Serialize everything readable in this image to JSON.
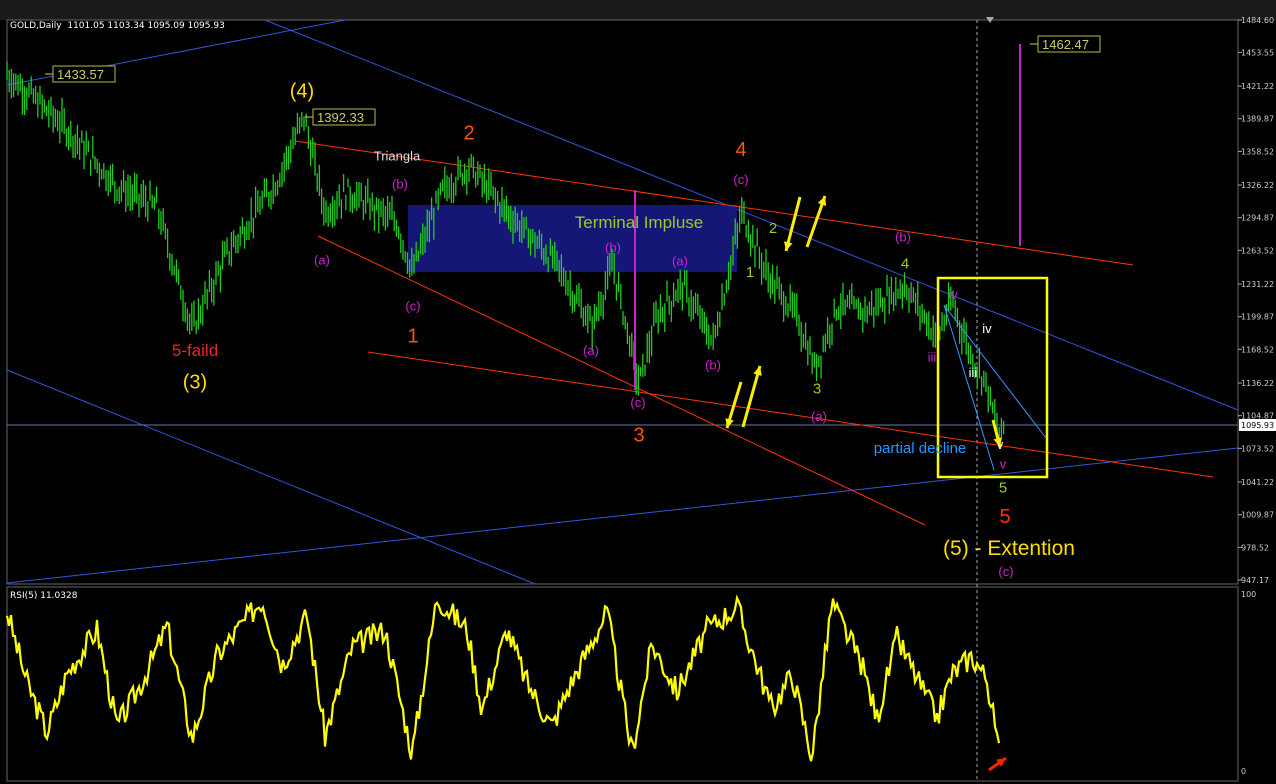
{
  "header": {
    "symbol_line": "GOLD,Daily  1101.05 1103.34 1095.09 1095.93",
    "rsi_line": "RSI(5) 11.0328"
  },
  "colors": {
    "candle": "#22cc22",
    "rsi": "#ffff00",
    "trend_red": "#ff3300",
    "trend_blue": "#3355dd",
    "magenta": "#cc22cc",
    "yellow_box": "#ffff00",
    "terminal_box": "#1a1a8c"
  },
  "chart_data": {
    "type": "candlestick",
    "symbol": "GOLD",
    "timeframe": "Daily",
    "ohlc_last": {
      "open": 1101.05,
      "high": 1103.34,
      "low": 1095.09,
      "close": 1095.93
    },
    "price_axis_ticks": [
      "1484.60",
      "1453.55",
      "1421.22",
      "1389.87",
      "1358.52",
      "1326.22",
      "1294.87",
      "1263.52",
      "1231.22",
      "1199.87",
      "1168.52",
      "1136.22",
      "1104.87",
      "1073.52",
      "1041.22",
      "1009.87",
      "978.52",
      "947.17"
    ],
    "current_price_tag": "1095.93",
    "ylim": [
      947.17,
      1484.6
    ],
    "price_labels": [
      {
        "text": "1433.57",
        "price": 1433.57
      },
      {
        "text": "1392.33",
        "price": 1392.33
      },
      {
        "text": "1462.47",
        "price": 1462.47
      }
    ],
    "path_anchors": [
      {
        "t": 0,
        "p": 1433
      },
      {
        "t": 60,
        "p": 1380
      },
      {
        "t": 110,
        "p": 1325
      },
      {
        "t": 150,
        "p": 1305
      },
      {
        "t": 185,
        "p": 1188
      },
      {
        "t": 220,
        "p": 1260
      },
      {
        "t": 270,
        "p": 1330
      },
      {
        "t": 297,
        "p": 1392
      },
      {
        "t": 318,
        "p": 1300
      },
      {
        "t": 340,
        "p": 1320
      },
      {
        "t": 390,
        "p": 1290
      },
      {
        "t": 405,
        "p": 1242
      },
      {
        "t": 435,
        "p": 1320
      },
      {
        "t": 462,
        "p": 1345
      },
      {
        "t": 500,
        "p": 1300
      },
      {
        "t": 550,
        "p": 1250
      },
      {
        "t": 585,
        "p": 1190
      },
      {
        "t": 606,
        "p": 1250
      },
      {
        "t": 632,
        "p": 1135
      },
      {
        "t": 650,
        "p": 1200
      },
      {
        "t": 675,
        "p": 1230
      },
      {
        "t": 706,
        "p": 1175
      },
      {
        "t": 735,
        "p": 1300
      },
      {
        "t": 760,
        "p": 1240
      },
      {
        "t": 790,
        "p": 1200
      },
      {
        "t": 808,
        "p": 1150
      },
      {
        "t": 830,
        "p": 1210
      },
      {
        "t": 860,
        "p": 1205
      },
      {
        "t": 898,
        "p": 1230
      },
      {
        "t": 930,
        "p": 1180
      },
      {
        "t": 945,
        "p": 1215
      },
      {
        "t": 965,
        "p": 1160
      },
      {
        "t": 978,
        "p": 1140
      },
      {
        "t": 992,
        "p": 1085
      },
      {
        "t": 998,
        "p": 1096
      }
    ],
    "rsi": {
      "name": "RSI(5)",
      "last_value": 11.0328,
      "ticks": [
        "100",
        "0"
      ],
      "ylim": [
        0,
        100
      ],
      "path_anchors": [
        {
          "t": 0,
          "v": 90
        },
        {
          "t": 20,
          "v": 50
        },
        {
          "t": 40,
          "v": 22
        },
        {
          "t": 60,
          "v": 55
        },
        {
          "t": 90,
          "v": 80
        },
        {
          "t": 110,
          "v": 25
        },
        {
          "t": 135,
          "v": 50
        },
        {
          "t": 160,
          "v": 82
        },
        {
          "t": 185,
          "v": 18
        },
        {
          "t": 210,
          "v": 65
        },
        {
          "t": 255,
          "v": 97
        },
        {
          "t": 275,
          "v": 60
        },
        {
          "t": 300,
          "v": 88
        },
        {
          "t": 318,
          "v": 20
        },
        {
          "t": 345,
          "v": 70
        },
        {
          "t": 378,
          "v": 80
        },
        {
          "t": 405,
          "v": 10
        },
        {
          "t": 430,
          "v": 98
        },
        {
          "t": 460,
          "v": 80
        },
        {
          "t": 475,
          "v": 35
        },
        {
          "t": 500,
          "v": 80
        },
        {
          "t": 520,
          "v": 50
        },
        {
          "t": 545,
          "v": 25
        },
        {
          "t": 560,
          "v": 45
        },
        {
          "t": 600,
          "v": 90
        },
        {
          "t": 625,
          "v": 10
        },
        {
          "t": 645,
          "v": 72
        },
        {
          "t": 670,
          "v": 45
        },
        {
          "t": 700,
          "v": 80
        },
        {
          "t": 730,
          "v": 93
        },
        {
          "t": 765,
          "v": 35
        },
        {
          "t": 785,
          "v": 55
        },
        {
          "t": 805,
          "v": 8
        },
        {
          "t": 825,
          "v": 95
        },
        {
          "t": 855,
          "v": 60
        },
        {
          "t": 870,
          "v": 30
        },
        {
          "t": 890,
          "v": 75
        },
        {
          "t": 930,
          "v": 30
        },
        {
          "t": 945,
          "v": 55
        },
        {
          "t": 965,
          "v": 65
        },
        {
          "t": 980,
          "v": 52
        },
        {
          "t": 992,
          "v": 11
        }
      ]
    },
    "annotations": [
      {
        "text": "(4)",
        "color": "#ffdd00",
        "t": 295,
        "p": 1410
      },
      {
        "text": "5-faild",
        "color": "#ee2222",
        "t": 188,
        "p": 1162
      },
      {
        "text": "(3)",
        "color": "#ffdd00",
        "t": 188,
        "p": 1131
      },
      {
        "text": "Triangla",
        "color": "#dddddd",
        "t": 390,
        "p": 1350
      },
      {
        "text": "(b)",
        "color": "#cc22cc",
        "t": 393,
        "p": 1323
      },
      {
        "text": "(a)",
        "color": "#cc22cc",
        "t": 315,
        "p": 1250
      },
      {
        "text": "(c)",
        "color": "#cc22cc",
        "t": 406,
        "p": 1206
      },
      {
        "text": "1",
        "color": "#ff5500",
        "t": 406,
        "p": 1175
      },
      {
        "text": "2",
        "color": "#ff5500",
        "t": 462,
        "p": 1370
      },
      {
        "text": "Terminal Impluse",
        "color": "#99cc22",
        "t": 632,
        "p": 1285
      },
      {
        "text": "(b)",
        "color": "#cc22cc",
        "t": 606,
        "p": 1262
      },
      {
        "text": "(a)",
        "color": "#cc22cc",
        "t": 673,
        "p": 1249
      },
      {
        "text": "(a)",
        "color": "#cc22cc",
        "t": 584,
        "p": 1163
      },
      {
        "text": "(b)",
        "color": "#cc22cc",
        "t": 706,
        "p": 1149
      },
      {
        "text": "(c)",
        "color": "#cc22cc",
        "t": 631,
        "p": 1113
      },
      {
        "text": "3",
        "color": "#ff5500",
        "t": 632,
        "p": 1080
      },
      {
        "text": "4",
        "color": "#ff5500",
        "t": 734,
        "p": 1354
      },
      {
        "text": "(c)",
        "color": "#cc22cc",
        "t": 734,
        "p": 1327
      },
      {
        "text": "2",
        "color": "#99cc22",
        "t": 766,
        "p": 1280
      },
      {
        "text": "1",
        "color": "#99cc22",
        "t": 743,
        "p": 1238
      },
      {
        "text": "3",
        "color": "#99cc22",
        "t": 810,
        "p": 1126
      },
      {
        "text": "(a)",
        "color": "#cc22cc",
        "t": 812,
        "p": 1100
      },
      {
        "text": "(b)",
        "color": "#cc22cc",
        "t": 896,
        "p": 1272
      },
      {
        "text": "4",
        "color": "#99cc22",
        "t": 898,
        "p": 1246
      },
      {
        "text": "i",
        "color": "#cc22cc",
        "t": 904,
        "p": 1217
      },
      {
        "text": "iii",
        "color": "#cc22cc",
        "t": 925,
        "p": 1157
      },
      {
        "text": "iv",
        "color": "#cc22cc",
        "t": 946,
        "p": 1217
      },
      {
        "text": "iv",
        "color": "#ffffff",
        "t": 980,
        "p": 1184
      },
      {
        "text": "iii",
        "color": "#ffffff",
        "t": 966,
        "p": 1142
      },
      {
        "text": "v",
        "color": "#ffffff",
        "t": 993,
        "p": 1073
      },
      {
        "text": "v",
        "color": "#cc22cc",
        "t": 996,
        "p": 1054
      },
      {
        "text": "partial decline",
        "color": "#2299ff",
        "t": 913,
        "p": 1069
      },
      {
        "text": "5",
        "color": "#99cc22",
        "t": 996,
        "p": 1031
      },
      {
        "text": "5",
        "color": "#ff3300",
        "t": 998,
        "p": 1002
      },
      {
        "text": "(5) -  Extention",
        "color": "#ffdd00",
        "t": 1002,
        "p": 971
      },
      {
        "text": "(c)",
        "color": "#cc22cc",
        "t": 999,
        "p": 951
      }
    ]
  }
}
